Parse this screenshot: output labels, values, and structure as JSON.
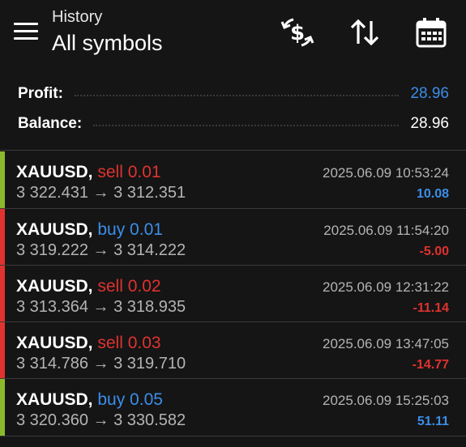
{
  "header": {
    "subtitle": "History",
    "title": "All symbols",
    "icons": [
      "menu-icon",
      "currency-exchange-icon",
      "sort-icon",
      "calendar-icon"
    ]
  },
  "summary": {
    "profit_label": "Profit:",
    "profit_value": "28.96",
    "balance_label": "Balance:",
    "balance_value": "28.96"
  },
  "trades": [
    {
      "symbol": "XAUUSD,",
      "side": "sell 0.01",
      "prices": "3 322.431 → 3 312.351",
      "time": "2025.06.09 10:53:24",
      "pl": "10.08"
    },
    {
      "symbol": "XAUUSD,",
      "side": "buy 0.01",
      "prices": "3 319.222 → 3 314.222",
      "time": "2025.06.09 11:54:20",
      "pl": "-5.00"
    },
    {
      "symbol": "XAUUSD,",
      "side": "sell 0.02",
      "prices": "3 313.364 → 3 318.935",
      "time": "2025.06.09 12:31:22",
      "pl": "-11.14"
    },
    {
      "symbol": "XAUUSD,",
      "side": "sell 0.03",
      "prices": "3 314.786 → 3 319.710",
      "time": "2025.06.09 13:47:05",
      "pl": "-14.77"
    },
    {
      "symbol": "XAUUSD,",
      "side": "buy 0.05",
      "prices": "3 320.360 → 3 330.582",
      "time": "2025.06.09 15:25:03",
      "pl": "51.11"
    }
  ],
  "colors": {
    "background": "#151515",
    "profit_blue": "#3b8ee9",
    "loss_red": "#e0322f",
    "win_bar": "#8cb92a",
    "loss_bar": "#e0322f"
  }
}
